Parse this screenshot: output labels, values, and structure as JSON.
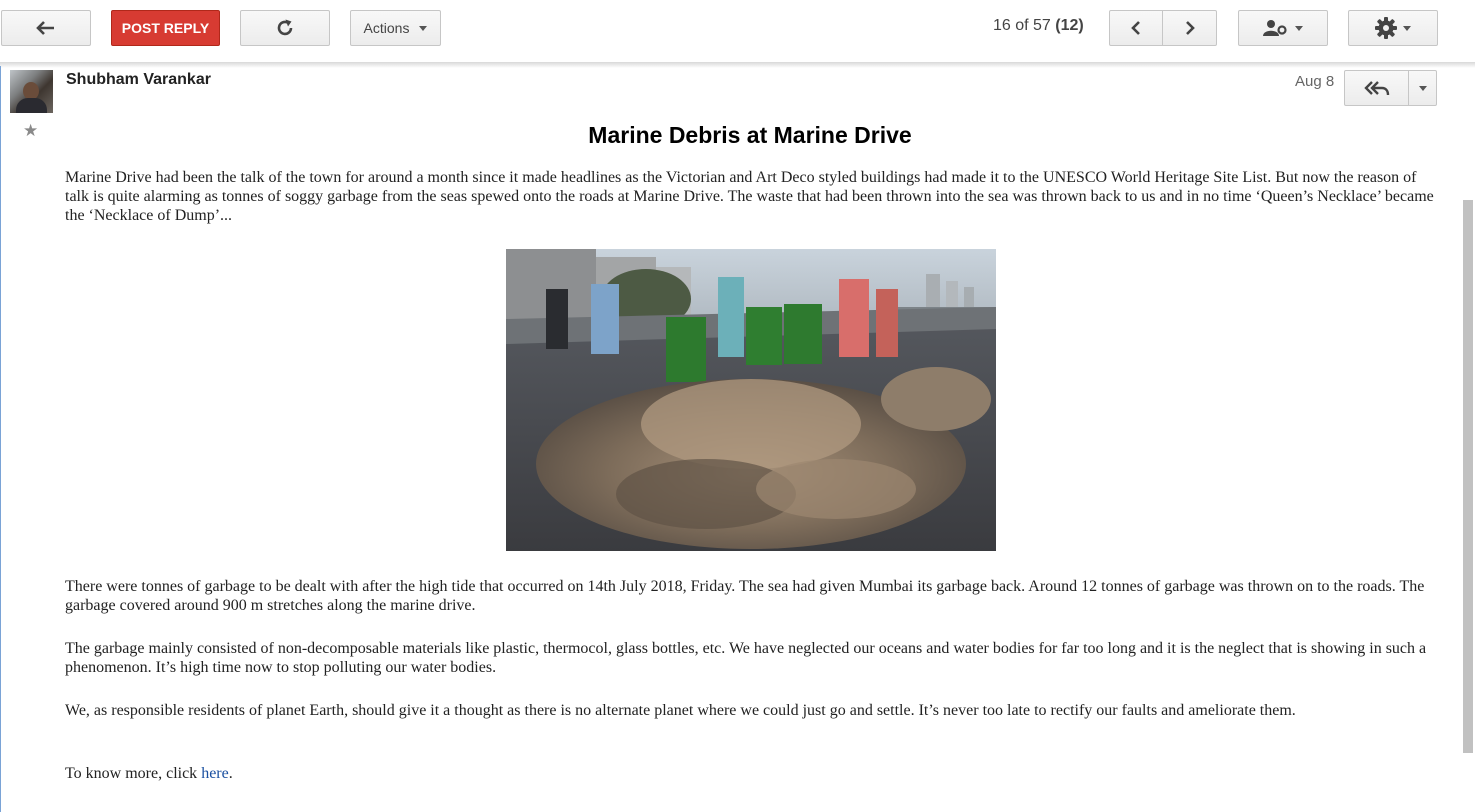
{
  "toolbar": {
    "back_icon": "back-arrow-icon",
    "post_reply_label": "POST REPLY",
    "refresh_icon": "refresh-icon",
    "actions_label": "Actions",
    "counter_prefix": "16 of 57",
    "counter_bold": "(12)",
    "prev_icon": "chevron-left-icon",
    "next_icon": "chevron-right-icon",
    "people_icon": "people-settings-icon",
    "settings_icon": "gear-icon"
  },
  "post": {
    "author": "Shubham Varankar",
    "date": "Aug 8",
    "title": "Marine Debris at Marine Drive",
    "paragraphs": [
      "Marine Drive had been the talk of the town for around a month since it made headlines as the Victorian and Art Deco styled buildings had made it to the UNESCO World Heritage Site List. But now the reason of talk is quite alarming as tonnes of soggy garbage from the seas spewed onto the roads at Marine Drive. The waste that had been thrown into the sea was thrown back to us and in no time ‘Queen’s Necklace’ became the ‘Necklace of Dump’...",
      "There were tonnes of garbage to be dealt with after the high tide that occurred on 14th July 2018, Friday. The sea had given Mumbai its garbage back. Around 12 tonnes of garbage was thrown on to the roads. The garbage covered around 900 m stretches along the marine drive.",
      "The garbage mainly consisted of non-decomposable materials like plastic, thermocol, glass bottles, etc. We have neglected our oceans and water bodies for far too long and it is the neglect that is showing in such a phenomenon. It’s high time now to stop polluting our water bodies.",
      "We, as responsible residents of planet Earth, should give it a thought as there is no alternate planet where we could just go and settle.  It’s never too late to rectify our faults and ameliorate them."
    ],
    "closing_prefix": "To know more, click ",
    "closing_link": "here",
    "closing_suffix": "."
  },
  "colors": {
    "post_reply_bg": "#d73b32",
    "link": "#1a4fa0"
  }
}
